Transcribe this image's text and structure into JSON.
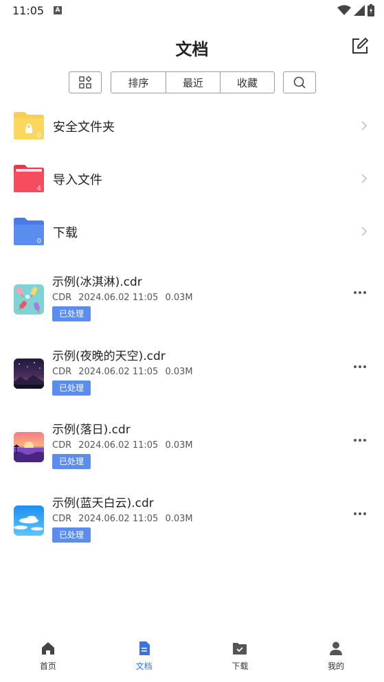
{
  "status": {
    "time": "11:05",
    "indicator": "A"
  },
  "header": {
    "title": "文档",
    "edit_icon": "edit-icon"
  },
  "toolbar": {
    "grid_icon": "grid-icon",
    "sort_label": "排序",
    "recent_label": "最近",
    "favorites_label": "收藏",
    "search_icon": "search-icon"
  },
  "folders": [
    {
      "name": "安全文件夹",
      "count": "0",
      "color": "#f6c94a",
      "icon": "lock-icon"
    },
    {
      "name": "导入文件",
      "count": "4",
      "color": "#f04a5a"
    },
    {
      "name": "下载",
      "count": "0",
      "color": "#5b8def"
    }
  ],
  "files": [
    {
      "name": "示例(冰淇淋).cdr",
      "type": "CDR",
      "date": "2024.06.02 11:05",
      "size": "0.03M",
      "status": "已处理"
    },
    {
      "name": "示例(夜晚的天空).cdr",
      "type": "CDR",
      "date": "2024.06.02 11:05",
      "size": "0.03M",
      "status": "已处理"
    },
    {
      "name": "示例(落日).cdr",
      "type": "CDR",
      "date": "2024.06.02 11:05",
      "size": "0.03M",
      "status": "已处理"
    },
    {
      "name": "示例(蓝天白云).cdr",
      "type": "CDR",
      "date": "2024.06.02 11:05",
      "size": "0.03M",
      "status": "已处理"
    }
  ],
  "nav": [
    {
      "label": "首页",
      "icon": "home-icon",
      "active": false
    },
    {
      "label": "文档",
      "icon": "document-icon",
      "active": true
    },
    {
      "label": "下载",
      "icon": "download-folder-icon",
      "active": false
    },
    {
      "label": "我的",
      "icon": "profile-icon",
      "active": false
    }
  ],
  "colors": {
    "accent": "#3a72e0",
    "badge": "#5b8def"
  }
}
